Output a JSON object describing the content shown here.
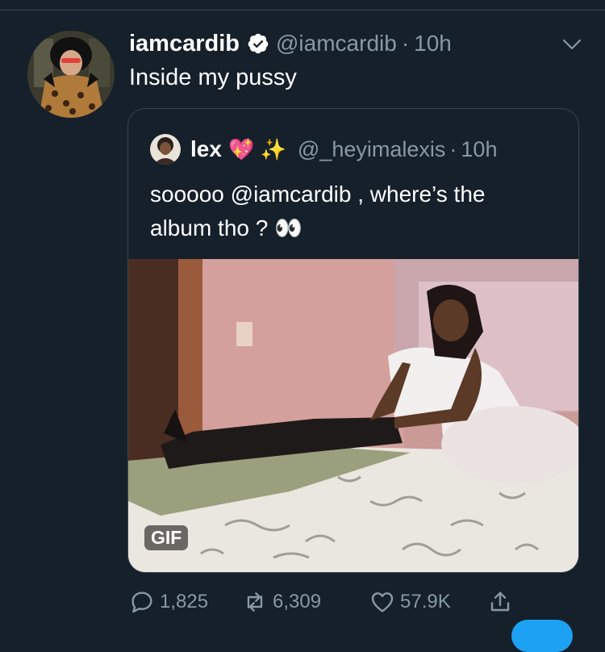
{
  "tweet": {
    "display_name": "iamcardib",
    "handle": "@iamcardib",
    "separator": "·",
    "time": "10h",
    "text": "Inside my pussy"
  },
  "quoted_tweet": {
    "display_name": "lex",
    "name_emojis": "💖 ✨",
    "handle": "@_heyimalexis",
    "separator": "·",
    "time": "10h",
    "text_line1": "sooooo @iamcardib , where’s the",
    "text_line2": "album tho ? 👀",
    "media_badge": "GIF"
  },
  "actions": {
    "reply_count": "1,825",
    "retweet_count": "6,309",
    "like_count": "57.9K"
  },
  "colors": {
    "background": "#15202b",
    "border": "#38444d",
    "secondary_text": "#8899a6",
    "accent": "#1da1f2"
  },
  "icons": [
    "verified-badge-icon",
    "chevron-down-icon",
    "reply-icon",
    "retweet-icon",
    "like-icon",
    "share-icon"
  ]
}
